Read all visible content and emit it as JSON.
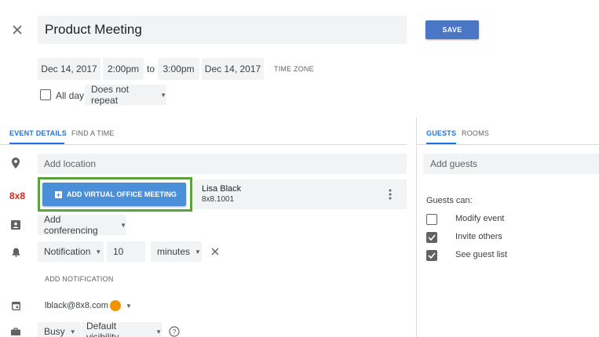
{
  "header": {
    "title": "Product Meeting",
    "save_label": "SAVE"
  },
  "datetime": {
    "start_date": "Dec 14, 2017",
    "start_time": "2:00pm",
    "to_label": "to",
    "end_time": "3:00pm",
    "end_date": "Dec 14, 2017",
    "timezone_label": "TIME ZONE",
    "allday_label": "All day",
    "repeat_value": "Does not repeat"
  },
  "tabs": {
    "event_details": "EVENT DETAILS",
    "find_time": "FIND A TIME",
    "guests": "GUESTS",
    "rooms": "ROOMS"
  },
  "details": {
    "location_placeholder": "Add location",
    "logo_text": "8x8",
    "virtual_button_label": "ADD VIRTUAL OFFICE MEETING",
    "user_name": "Lisa Black",
    "user_ext": "8x8.1001",
    "conferencing_value": "Add conferencing",
    "notification_type": "Notification",
    "notification_amount": "10",
    "notification_unit": "minutes",
    "add_notification_label": "ADD NOTIFICATION",
    "calendar_email": "lblack@8x8.com",
    "calendar_color": "#f09300",
    "busy_value": "Busy",
    "visibility_value": "Default visibility"
  },
  "guests": {
    "add_placeholder": "Add guests",
    "can_label": "Guests can:",
    "permissions": [
      {
        "label": "Modify event",
        "checked": false
      },
      {
        "label": "Invite others",
        "checked": true
      },
      {
        "label": "See guest list",
        "checked": true
      }
    ]
  },
  "colors": {
    "accent": "#4285f4",
    "save_button": "#4a76c5",
    "virtual_button": "#4a90d9",
    "highlight_border": "#5aa33a",
    "logo_red": "#e2231a"
  }
}
